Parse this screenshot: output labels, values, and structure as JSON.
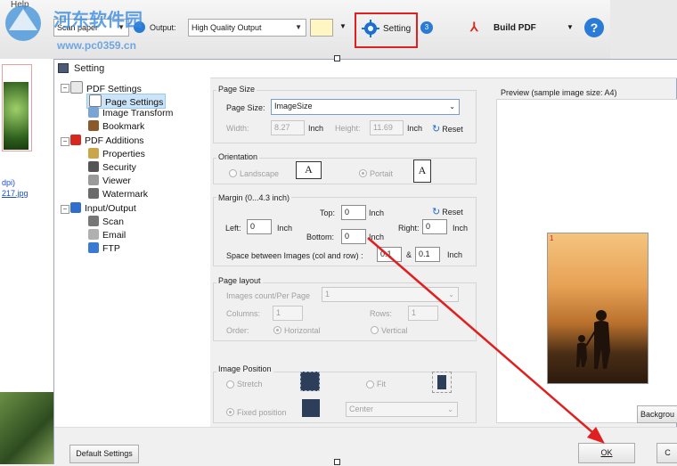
{
  "bg_app": {
    "menu_help": "Help",
    "scan_combo": "Scan paper",
    "output_label": "Output:",
    "output_value": "High Quality Output",
    "setting_label": "Setting",
    "step_badge": "3",
    "build_pdf_label": "Build PDF",
    "thumb_caption_1": "dpi)",
    "thumb_caption_2": "217.jpg",
    "watermark_site": "河东软件园",
    "watermark_url": "www.pc0359.cn"
  },
  "dialog": {
    "title": "Setting",
    "tree": [
      {
        "label": "PDF Settings",
        "icon": "pdf-settings-icon"
      },
      {
        "label": "Page Settings",
        "icon": "page-settings-icon",
        "selected": true
      },
      {
        "label": "Image Transform",
        "icon": "image-transform-icon"
      },
      {
        "label": "Bookmark",
        "icon": "bookmark-icon"
      },
      {
        "label": "PDF Additions",
        "icon": "pdf-additions-icon"
      },
      {
        "label": "Properties",
        "icon": "properties-icon"
      },
      {
        "label": "Security",
        "icon": "security-icon"
      },
      {
        "label": "Viewer",
        "icon": "viewer-icon"
      },
      {
        "label": "Watermark",
        "icon": "watermark-icon"
      },
      {
        "label": "Input/Output",
        "icon": "input-output-icon"
      },
      {
        "label": "Scan",
        "icon": "scan-icon"
      },
      {
        "label": "Email",
        "icon": "email-icon"
      },
      {
        "label": "FTP",
        "icon": "ftp-icon"
      }
    ],
    "page_size": {
      "group_title": "Page Size",
      "size_label": "Page Size:",
      "size_value": "ImageSize",
      "width_label": "Width:",
      "width_value": "8.27",
      "height_label": "Height:",
      "height_value": "11.69",
      "unit": "Inch",
      "reset_label": "Reset"
    },
    "orientation": {
      "group_title": "Orientation",
      "landscape": "Landscape",
      "portrait": "Portait",
      "glyph": "A"
    },
    "margin": {
      "group_title": "Margin (0...4.3 inch)",
      "top_label": "Top:",
      "top_value": "0",
      "left_label": "Left:",
      "left_value": "0",
      "right_label": "Right:",
      "right_value": "0",
      "bottom_label": "Bottom:",
      "bottom_value": "0",
      "unit": "Inch",
      "reset_label": "Reset",
      "space_label": "Space between Images (col and row) :",
      "space_col": "0.1",
      "space_and": "&",
      "space_row": "0.1"
    },
    "page_layout": {
      "group_title": "Page layout",
      "count_label": "Images count/Per Page",
      "count_value": "1",
      "columns_label": "Columns:",
      "columns_value": "1",
      "rows_label": "Rows:",
      "rows_value": "1",
      "order_label": "Order:",
      "horizontal": "Horizontal",
      "vertical": "Vertical"
    },
    "image_position": {
      "group_title": "Image Position",
      "stretch": "Stretch",
      "fit": "Fit",
      "fixed": "Fixed position",
      "fixed_value": "Center"
    },
    "preview": {
      "title": "Preview (sample image size: A4)",
      "page_number": "1",
      "background_button": "Backgrou"
    },
    "default_button": "Default Settings",
    "ok_button": "OK",
    "cancel_button": "C"
  },
  "colors": {
    "highlight_red": "#e02020",
    "selection": "#cce4f7"
  }
}
